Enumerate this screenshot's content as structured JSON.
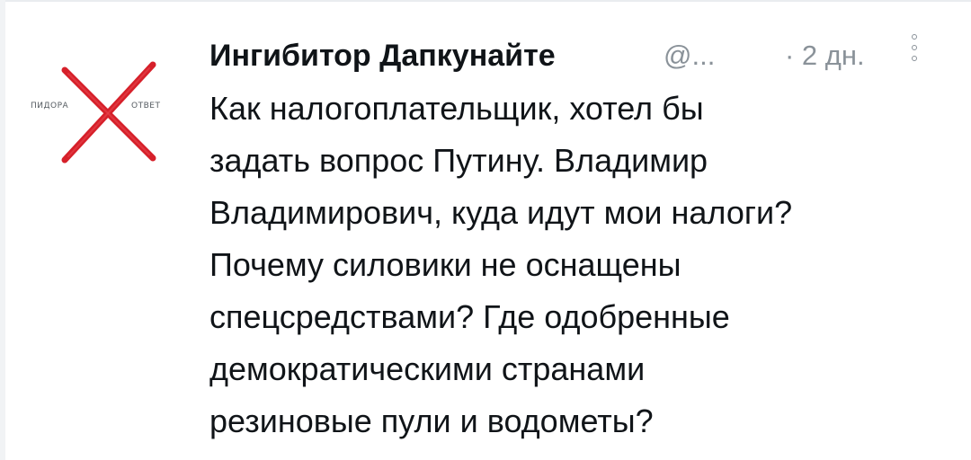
{
  "post": {
    "author": "Ингибитор Дапкунайте",
    "handle": "@...",
    "time": "· 2 дн.",
    "more_icon": "vertical-dots-icon",
    "lines": [
      "Как налогоплательщик, хотел бы",
      "задать вопрос Путину. Владимир",
      "Владимирович, куда идут мои налоги?",
      "Почему силовики не оснащены",
      "спецсредствами? Где одобренные",
      "демократическими странами",
      "резиновые пули и водометы?"
    ]
  },
  "avatar": {
    "icon": "red-cross-icon",
    "left_text": "ПИДОРА",
    "right_text": "ОТВЕТ",
    "cross_color": "#d6202a"
  },
  "colors": {
    "text": "#101418",
    "muted": "#8a9299",
    "background": "#ffffff"
  }
}
